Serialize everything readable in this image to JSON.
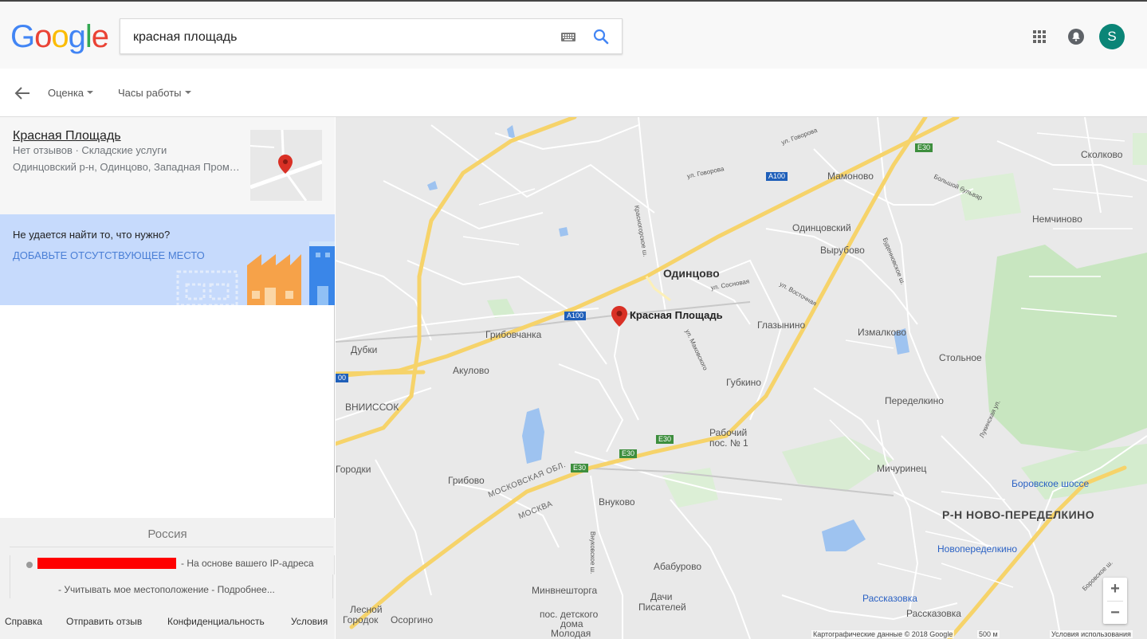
{
  "header": {
    "logo_letters": [
      "G",
      "o",
      "o",
      "g",
      "l",
      "e"
    ],
    "logo_colors": [
      "#4285f4",
      "#ea4335",
      "#fbbc05",
      "#4285f4",
      "#34a853",
      "#ea4335"
    ],
    "search_value": "красная площадь",
    "avatar_letter": "S",
    "avatar_color": "#0b8577"
  },
  "filters": {
    "rating_label": "Оценка",
    "hours_label": "Часы работы"
  },
  "result": {
    "title": "Красная Площадь",
    "meta": "Нет отзывов · Складские услуги",
    "address": "Одинцовский р-н, Одинцово, Западная Пром…"
  },
  "promo": {
    "question": "Не удается найти то, что нужно?",
    "link": "ДОБАВЬТЕ ОТСУТСТВУЮЩЕЕ МЕСТО"
  },
  "footer": {
    "country": "Россия",
    "ip_text": "- На основе вашего IP-адреса",
    "use_location": "- Учитывать мое местоположение - Подробнее...",
    "links": [
      "Справка",
      "Отправить отзыв",
      "Конфиденциальность",
      "Условия"
    ]
  },
  "map": {
    "marker_label": "Красная Площадь",
    "towns": {
      "odintsovo": "Одинцово",
      "mamonovo": "Мамоново",
      "skolkovo": "Сколково",
      "nemchinovo": "Немчиново",
      "odintsovsky": "Одинцовский",
      "vyrubovo": "Вырубово",
      "glazynino": "Глазынино",
      "izmalkovo": "Измалково",
      "stolnoe": "Стольное",
      "gribovchanka": "Грибовчанка",
      "dubki": "Дубки",
      "akulovo": "Акулово",
      "vniissok": "ВНИИССОК",
      "gubkino": "Губкино",
      "peredelkino": "Переделкино",
      "rabochiy": "Рабочий",
      "rabochiy2": "пос. № 1",
      "michurinets": "Мичуринец",
      "borovskoe": "Боровское шоссе",
      "novoperedelkino_district": "Р-Н НОВО-ПЕРЕДЕЛКИНО",
      "novoperedelkino": "Новопеределкино",
      "gribovo": "Грибово",
      "vnukovo": "Внуково",
      "gorodki": "Городки",
      "moskovskaya": "МОСКОВСКАЯ ОБЛ.",
      "moskva": "МОСКВА",
      "ababurovo": "Абабурово",
      "minvneshtorga": "Минвнешторга",
      "dachi1": "Дачи",
      "dachi2": "Писателей",
      "lesnoy1": "Лесной",
      "lesnoy2": "Городок",
      "osorgino": "Осоргино",
      "detsky1": "пос. детского",
      "detsky2": "дома",
      "detsky3": "Молодая",
      "rasskazovka_st": "Рассказовка",
      "rasskazovka": "Рассказовка"
    },
    "streets": {
      "govorova": "ул. Говорова",
      "govorova2": "ул. Говорова",
      "krasnogorskoe": "Красногорское ш.",
      "borovaya": "Большой бульвар",
      "budennovskoe": "Буденновское ш.",
      "sosnovaya": "ул. Сосновая",
      "vostochnaya": "ул. Восточная",
      "makovskogo": "ул. Маковского",
      "vnukovskoe": "Внуковское ш.",
      "lukinskaya": "Лукинская ул.",
      "borovskoe_sh": "Боровское ш.",
      "vorobyovskoe": "Боровское ш."
    },
    "shields": {
      "a100_a": "A100",
      "a100_b": "A100",
      "e30_a": "E30",
      "e30_b": "E30",
      "e30_c": "E30",
      "e30_d": "E30",
      "a100_edge": "00"
    },
    "attribution": "Картографические данные © 2018 Google",
    "scale": "500 м",
    "terms": "Условия использования",
    "zoom_in": "+",
    "zoom_out": "−"
  }
}
